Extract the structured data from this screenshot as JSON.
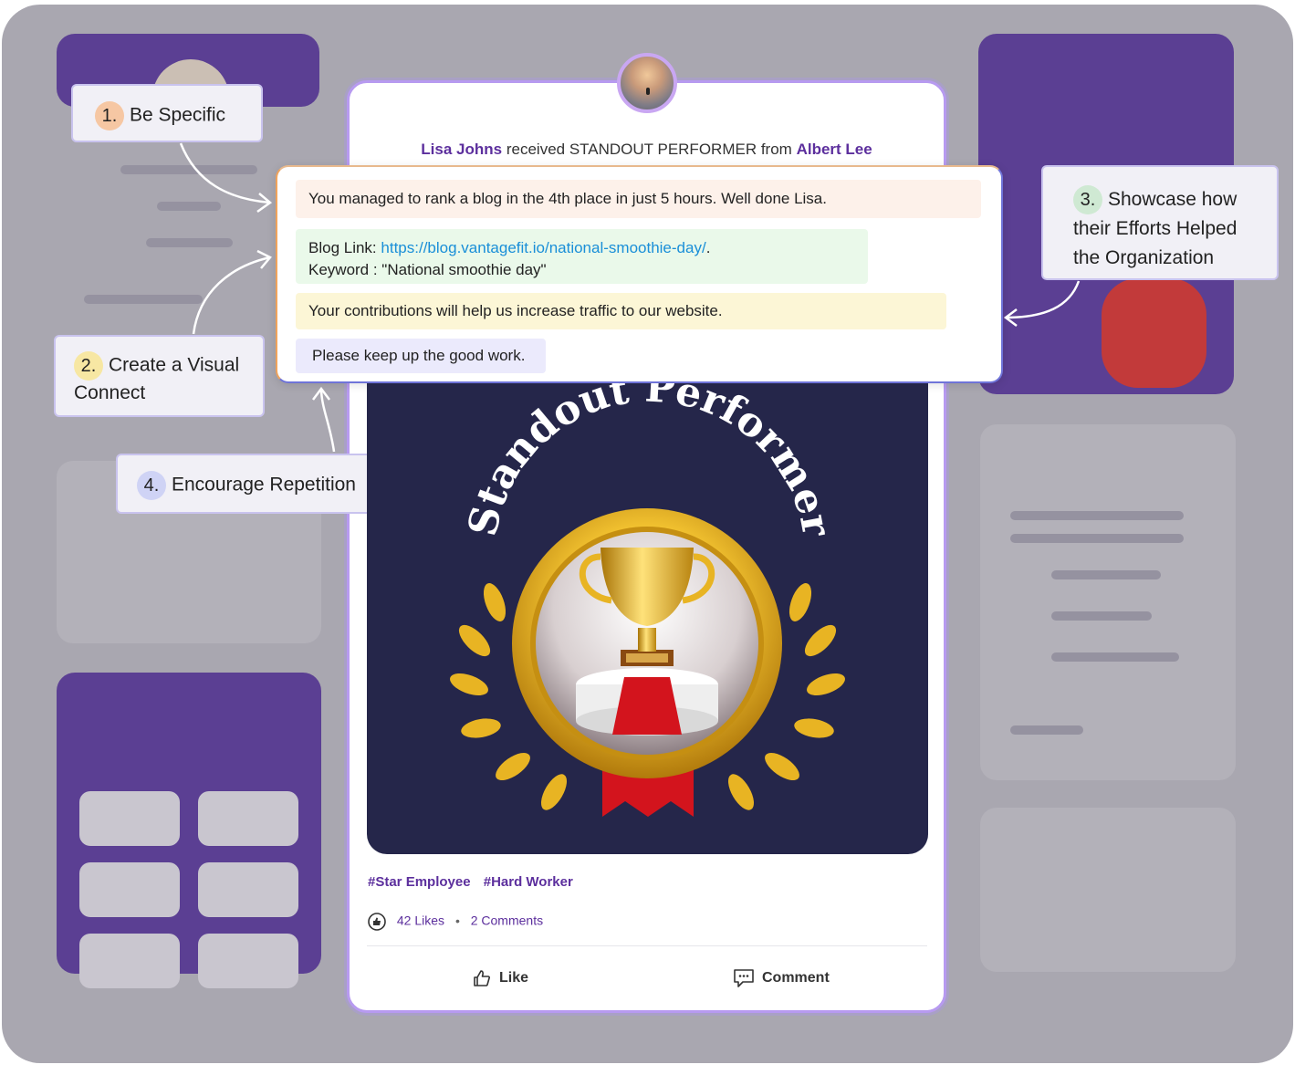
{
  "post": {
    "recipient": "Lisa Johns",
    "received_text": "received STANDOUT PERFORMER from",
    "giver": "Albert Lee",
    "messages": {
      "specific": "You managed to rank a blog in the 4th place in just 5 hours. Well done Lisa.",
      "blog_label": "Blog Link:",
      "blog_url": "https://blog.vantagefit.io/national-smoothie-day/",
      "blog_period": ".",
      "keyword_line": "Keyword : \"National smoothie day\"",
      "impact": "Your contributions will help us increase traffic to our website.",
      "encourage": "Please keep up the good work."
    },
    "badge_title": "Standout Performer",
    "tags": [
      "#Star Employee",
      "#Hard Worker"
    ],
    "likes": "42 Likes",
    "separator": "•",
    "comments": "2 Comments",
    "actions": {
      "like": "Like",
      "comment": "Comment"
    }
  },
  "callouts": [
    {
      "num": "1.",
      "text": "Be Specific",
      "color": "#f6c7a3"
    },
    {
      "num": "2.",
      "text_line1": "Create a Visual",
      "text_line2": "Connect",
      "color": "#f7e7a3"
    },
    {
      "num": "3.",
      "text_line1": "Showcase how",
      "text_line2": "their Efforts Helped",
      "text_line3": "the Organization",
      "color": "#cfe9d3"
    },
    {
      "num": "4.",
      "text": "Encourage Repetition",
      "color": "#cfd3f5"
    }
  ],
  "colors": {
    "brand_purple": "#5c2f9d",
    "link_blue": "#1a8fd8",
    "badge_gold": "#e8b423",
    "art_bg": "#25264a"
  }
}
